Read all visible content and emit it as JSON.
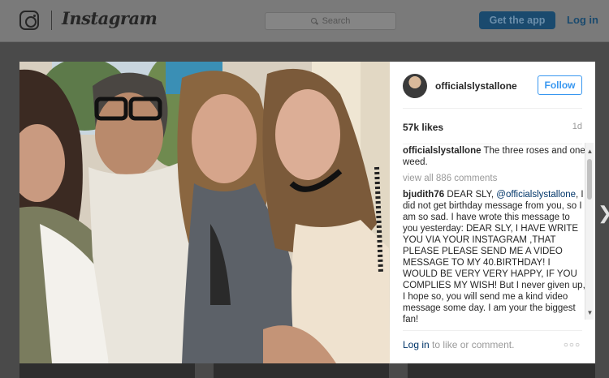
{
  "nav": {
    "brand": "Instagram",
    "search_placeholder": "Search",
    "get_app_label": "Get the app",
    "login_label": "Log in"
  },
  "post": {
    "username": "officialslystallone",
    "follow_label": "Follow",
    "likes": "57k likes",
    "age": "1d",
    "caption": {
      "user": "officialslystallone",
      "text": "The three roses and one weed."
    },
    "view_all": "view all 886 comments",
    "comments": [
      {
        "user": "bjudith76",
        "pre": "DEAR SLY, ",
        "mention": "@officialslystallone",
        "text": ", I did not get birthday message from you, so I am so sad. I have wrote this message to you yesterday: DEAR SLY, I HAVE WRITE YOU VIA YOUR INSTAGRAM ,THAT PLEASE PLEASE SEND ME A VIDEO MESSAGE TO MY 40.BIRTHDAY! I WOULD BE VERY VERY HAPPY, IF YOU COMPLIES MY WISH! But I never given up, I hope so, you will send me a kind video message some day. I am your the biggest fan!"
      }
    ],
    "footer": {
      "login_link": "Log in",
      "login_suffix": " to like or comment."
    }
  },
  "icons": {
    "logo": "instagram-glyph-icon",
    "search": "search-icon",
    "more": "more-options-icon",
    "next": "chevron-right-icon"
  },
  "colors": {
    "accent": "#3897f0",
    "link": "#003569",
    "overlay": "#4a4a4a"
  }
}
